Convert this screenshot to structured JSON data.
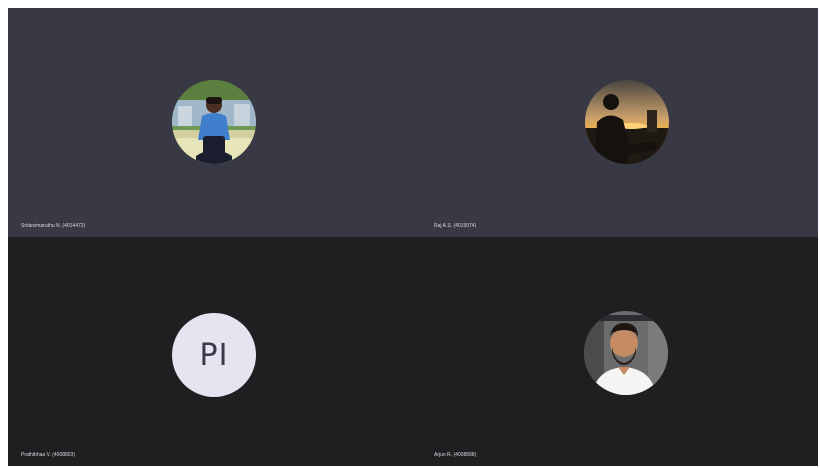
{
  "participants": [
    {
      "name": "Sridevimaruthu N. (4014472)",
      "avatar_kind": "photo",
      "photo_icon": "person-photo-icon"
    },
    {
      "name": "Raj A.S. (4015074)",
      "avatar_kind": "photo",
      "photo_icon": "silhouette-photo-icon"
    },
    {
      "name": "Prathibhaa V. (4008803)",
      "avatar_kind": "initials",
      "initials": "PI"
    },
    {
      "name": "Arjun R. (4008898)",
      "avatar_kind": "photo",
      "photo_icon": "person-photo-icon"
    }
  ],
  "colors": {
    "tile_top": "#393845",
    "tile_bottom": "#1f1f21",
    "initials_bg": "#e7e4f2",
    "initials_text": "#3b3948"
  }
}
